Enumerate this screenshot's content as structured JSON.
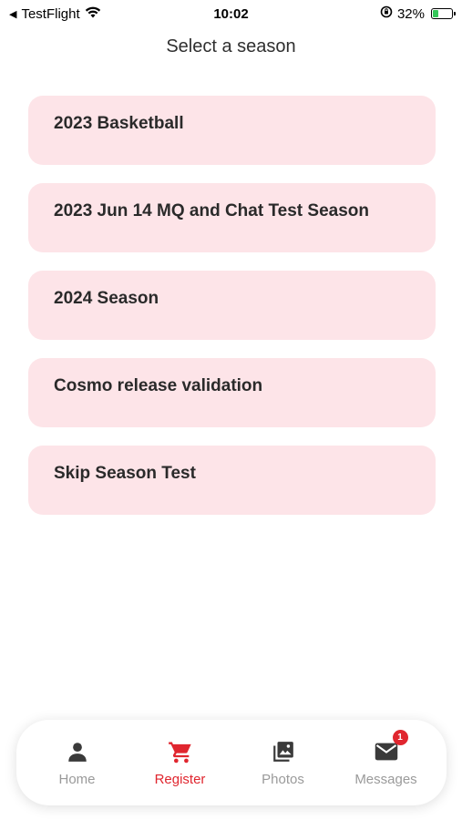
{
  "status_bar": {
    "back_app": "TestFlight",
    "time": "10:02",
    "battery_percent": "32%",
    "battery_level": 0.32
  },
  "header": {
    "title": "Select a season"
  },
  "seasons": [
    {
      "label": "2023 Basketball"
    },
    {
      "label": "2023 Jun 14 MQ and Chat Test Season"
    },
    {
      "label": "2024 Season"
    },
    {
      "label": "Cosmo release validation"
    },
    {
      "label": "Skip Season Test"
    }
  ],
  "tab_bar": {
    "tabs": [
      {
        "label": "Home",
        "icon": "person-icon",
        "active": false
      },
      {
        "label": "Register",
        "icon": "cart-icon",
        "active": true
      },
      {
        "label": "Photos",
        "icon": "photos-icon",
        "active": false
      },
      {
        "label": "Messages",
        "icon": "mail-icon",
        "active": false,
        "badge": "1"
      }
    ]
  },
  "colors": {
    "accent": "#e0262f",
    "card_bg": "#fde4e8",
    "inactive_icon": "#3a3a3a",
    "inactive_label": "#9a9a9a"
  }
}
